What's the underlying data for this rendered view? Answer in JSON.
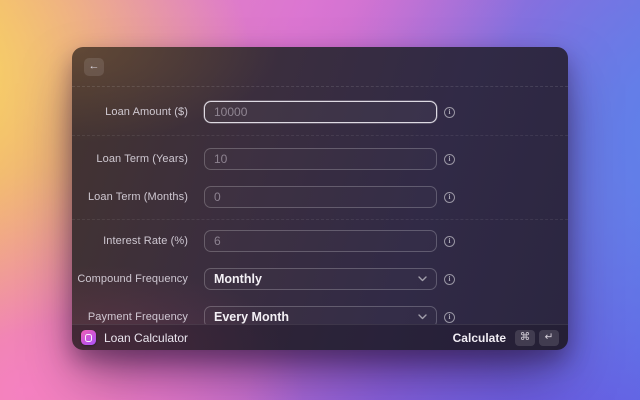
{
  "header": {
    "back_label": "←"
  },
  "form": {
    "fields": [
      {
        "label": "Loan Amount ($)",
        "value": "10000",
        "type": "textfield",
        "focused": true
      },
      {
        "label": "Loan Term (Years)",
        "value": "10",
        "type": "textfield",
        "focused": false
      },
      {
        "label": "Loan Term (Months)",
        "value": "0",
        "type": "textfield",
        "focused": false
      },
      {
        "label": "Interest Rate (%)",
        "value": "6",
        "type": "textfield",
        "focused": false
      },
      {
        "label": "Compound Frequency",
        "value": "Monthly",
        "type": "dropdown",
        "focused": false
      },
      {
        "label": "Payment Frequency",
        "value": "Every Month",
        "type": "dropdown",
        "focused": false
      }
    ],
    "info_glyph": "i"
  },
  "footer": {
    "app_name": "Loan Calculator",
    "primary_action": "Calculate",
    "shortcut": [
      "⌘",
      "↵"
    ]
  },
  "colors": {
    "focus_ring": "#f0ecf4",
    "window_tint_left": "#443430",
    "window_tint_right": "#2b2640",
    "app_icon_gradient": [
      "#f061b4",
      "#a855f7"
    ],
    "background_gradient": [
      "#f8d863",
      "#f780c4",
      "#de78d6",
      "#5c84eb",
      "#6858e2"
    ]
  }
}
